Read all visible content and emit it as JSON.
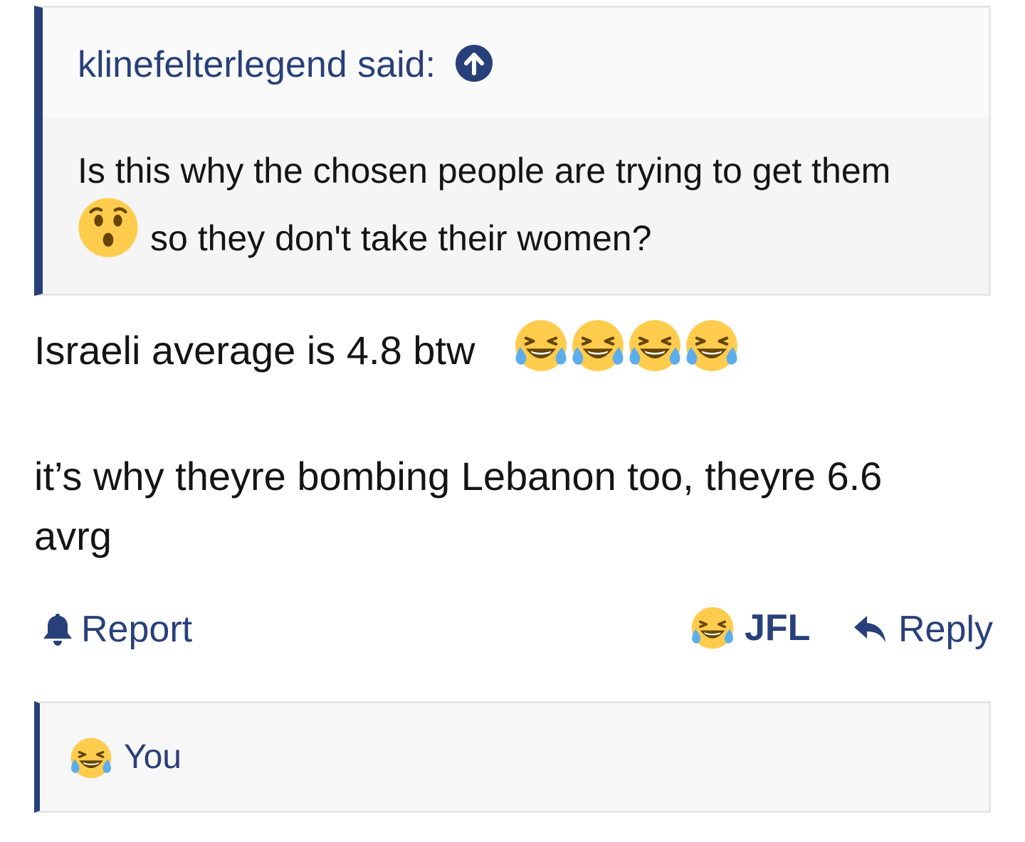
{
  "quote": {
    "attribution": "klinefelterlegend said:",
    "text_line1": "Is this why the chosen people are trying to get them",
    "text_line2": "so they don't take their women?",
    "emoji": "hushed-face-icon"
  },
  "post": {
    "line1": "Israeli average is 4.8 btw",
    "line1_emoji": "face-with-tears-of-joy-icon",
    "line1_emoji_count": 4,
    "line2": "it’s why theyre bombing Lebanon too, theyre 6.6 avrg"
  },
  "actions": {
    "report_label": "Report",
    "reaction_label": "JFL",
    "reply_label": "Reply"
  },
  "reactions": {
    "users": "You",
    "emoji": "face-with-tears-of-joy-icon"
  },
  "colors": {
    "accent": "#28407a",
    "text": "#141414",
    "quote_bg": "#f5f5f5",
    "border": "#e6e6e6",
    "emoji_yellow": "#ffcc4d",
    "tear_blue": "#5dadec"
  }
}
